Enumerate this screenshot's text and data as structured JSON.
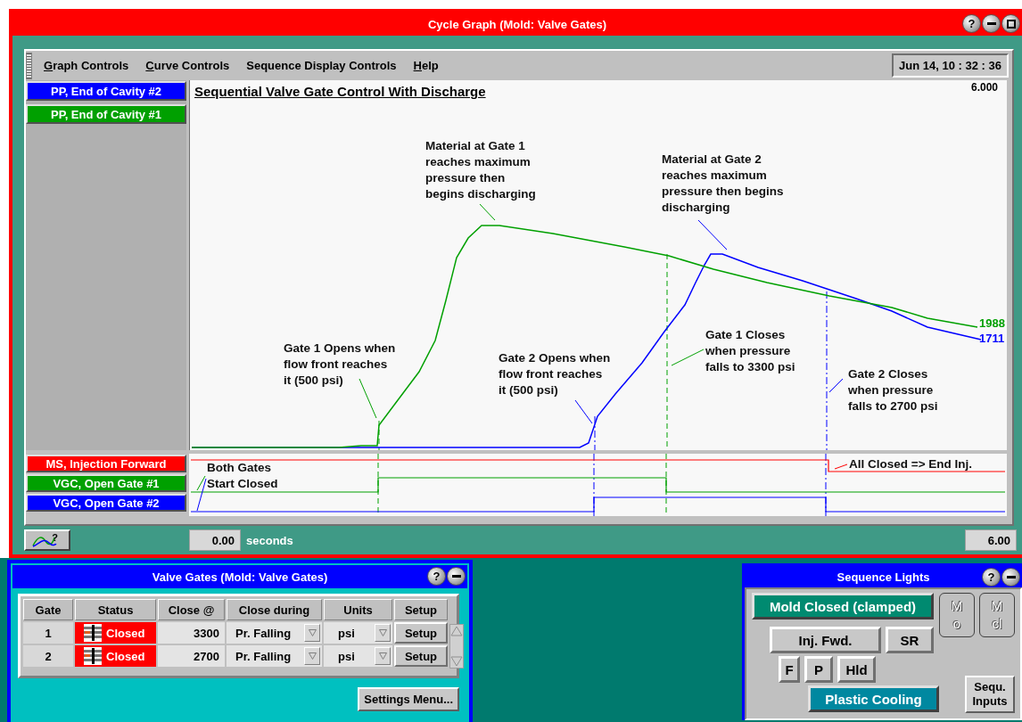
{
  "cycle_window": {
    "title": "Cycle Graph (Mold: Valve Gates)",
    "help_button": "?"
  },
  "menu": [
    {
      "label": "Graph Controls",
      "mnemonic": true
    },
    {
      "label": "Curve Controls",
      "mnemonic": true
    },
    {
      "label": "Sequence Display Controls",
      "mnemonic": false
    },
    {
      "label": "Help",
      "mnemonic": true
    }
  ],
  "clock": "Jun 14, 10 : 32 : 36",
  "graph": {
    "title": "Sequential Valve Gate Control With Discharge",
    "y_max": "6.000",
    "curves": [
      {
        "label": "PP, End of Cavity #2",
        "color": "#0000ff"
      },
      {
        "label": "PP, End of Cavity #1",
        "color": "#00a000"
      }
    ],
    "end_values": [
      {
        "text": "1988",
        "color": "#00a000"
      },
      {
        "text": "1711",
        "color": "#0000ff"
      }
    ],
    "annotations": [
      {
        "lines": [
          "Material at Gate 1",
          "reaches maximum",
          "pressure then",
          "begins discharging"
        ]
      },
      {
        "lines": [
          "Material at Gate 2",
          "reaches maximum",
          "pressure then begins",
          "discharging"
        ]
      },
      {
        "lines": [
          "Gate 1 Opens when",
          "flow front reaches",
          "it (500 psi)"
        ]
      },
      {
        "lines": [
          "Gate 2 Opens when",
          "flow front reaches",
          "it (500 psi)"
        ]
      },
      {
        "lines": [
          "Gate 1 Closes",
          "when pressure",
          "falls to 3300 psi"
        ]
      },
      {
        "lines": [
          "Gate 2 Closes",
          "when pressure",
          "falls to 2700 psi"
        ]
      }
    ]
  },
  "signals": {
    "traces": [
      {
        "label": "MS, Injection Forward",
        "color": "#ff0000"
      },
      {
        "label": "VGC, Open Gate #1",
        "color": "#00a000"
      },
      {
        "label": "VGC, Open Gate #2",
        "color": "#0000ff"
      }
    ],
    "annotations": [
      {
        "lines": [
          "Both Gates",
          "Start Closed"
        ]
      },
      {
        "lines": [
          "All Closed => End Inj."
        ]
      }
    ]
  },
  "time_axis": {
    "help_button": "?",
    "start": "0.00",
    "unit": "seconds",
    "end": "6.00"
  },
  "valve_gates": {
    "title": "Valve Gates (Mold: Valve Gates)",
    "help_button": "?",
    "columns": [
      "Gate",
      "Status",
      "Close @",
      "Close during",
      "Units",
      "Setup"
    ],
    "rows": [
      {
        "gate": "1",
        "status": "Closed",
        "closed": true,
        "close_at": "3300",
        "close_during": "Pr. Falling",
        "units": "psi",
        "setup": "Setup"
      },
      {
        "gate": "2",
        "status": "Closed",
        "closed": true,
        "close_at": "2700",
        "close_during": "Pr. Falling",
        "units": "psi",
        "setup": "Setup"
      }
    ],
    "settings_button": "Settings Menu..."
  },
  "sequence_lights": {
    "title": "Sequence Lights",
    "help_button": "?",
    "lights": [
      {
        "label": "Mold Closed (clamped)",
        "kind": "light",
        "on": true,
        "color": "#008a70"
      },
      {
        "label": "Inj. Fwd.",
        "kind": "light",
        "on": false
      },
      {
        "label": "SR",
        "kind": "light",
        "on": false
      },
      {
        "label": "F",
        "kind": "light",
        "on": false
      },
      {
        "label": "P",
        "kind": "light",
        "on": false
      },
      {
        "label": "Hld",
        "kind": "light",
        "on": false
      },
      {
        "label": "Plastic Cooling",
        "kind": "light",
        "on": true,
        "color": "#0088a0"
      },
      {
        "label": "M o",
        "kind": "indicator",
        "on": false
      },
      {
        "label": "M cl",
        "kind": "indicator",
        "on": false
      },
      {
        "label": "Sequ. Inputs",
        "kind": "button"
      }
    ]
  }
}
